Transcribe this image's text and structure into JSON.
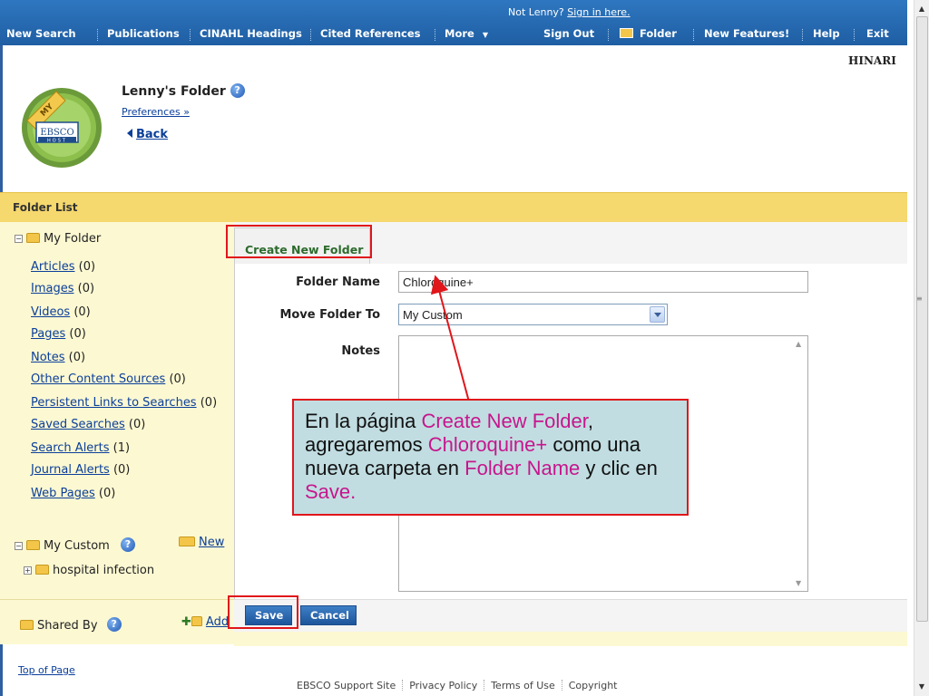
{
  "topbar": {
    "signin_prefix": "Not Lenny?",
    "signin_link": "Sign in here.",
    "nav": [
      "New Search",
      "Publications",
      "CINAHL Headings",
      "Cited References",
      "More"
    ],
    "right": [
      "Sign Out",
      "Folder",
      "New Features!",
      "Help",
      "Exit"
    ]
  },
  "header": {
    "institution": "HINARI",
    "folder_title": "Lenny's Folder",
    "preferences": "Preferences »",
    "back": "Back",
    "logo_text": "EBSCO",
    "logo_sub": "HOST",
    "logo_ribbon": "MY"
  },
  "folder_list": {
    "title": "Folder List",
    "my_folder": "My Folder",
    "items": [
      {
        "label": "Articles",
        "count": " (0)"
      },
      {
        "label": "Images",
        "count": " (0)"
      },
      {
        "label": "Videos",
        "count": " (0)"
      },
      {
        "label": "Pages",
        "count": " (0)"
      },
      {
        "label": "Notes",
        "count": " (0)"
      },
      {
        "label": "Other Content Sources",
        "count": " (0)"
      },
      {
        "label": "Persistent Links to Searches",
        "count": " (0)"
      },
      {
        "label": "Saved Searches",
        "count": " (0)"
      },
      {
        "label": "Search Alerts",
        "count": " (1)"
      },
      {
        "label": "Journal Alerts",
        "count": " (0)"
      },
      {
        "label": "Web Pages",
        "count": " (0)"
      }
    ],
    "my_custom": "My Custom",
    "new_link": "New",
    "custom_child": "hospital infection",
    "shared_by": "Shared By",
    "add_link": "Add"
  },
  "form": {
    "tab": "Create New Folder",
    "folder_name_label": "Folder Name",
    "folder_name_value": "Chloroquine+",
    "move_to_label": "Move Folder To",
    "move_to_value": "My Custom",
    "notes_label": "Notes",
    "save": "Save",
    "cancel": "Cancel"
  },
  "footer": {
    "top_of_page": "Top of Page",
    "links": [
      "EBSCO Support Site",
      "Privacy Policy",
      "Terms of Use",
      "Copyright"
    ]
  },
  "callout": {
    "t1": "En la página ",
    "p1": "Create New Folder",
    "t2": ", agregaremos ",
    "p2": "Chloroquine+",
    "t3": " como una nueva carpeta en ",
    "p3": "Folder Name",
    "t4": " y clic en ",
    "p4": "Save."
  },
  "colors": {
    "nav_blue": "#1f5ea3",
    "folder_bar": "#f5d86e",
    "sidebar_bg": "#fcf8d2",
    "highlight_red": "#e0161b",
    "callout_bg": "#c1dde1",
    "callout_accent": "#c6168d"
  }
}
